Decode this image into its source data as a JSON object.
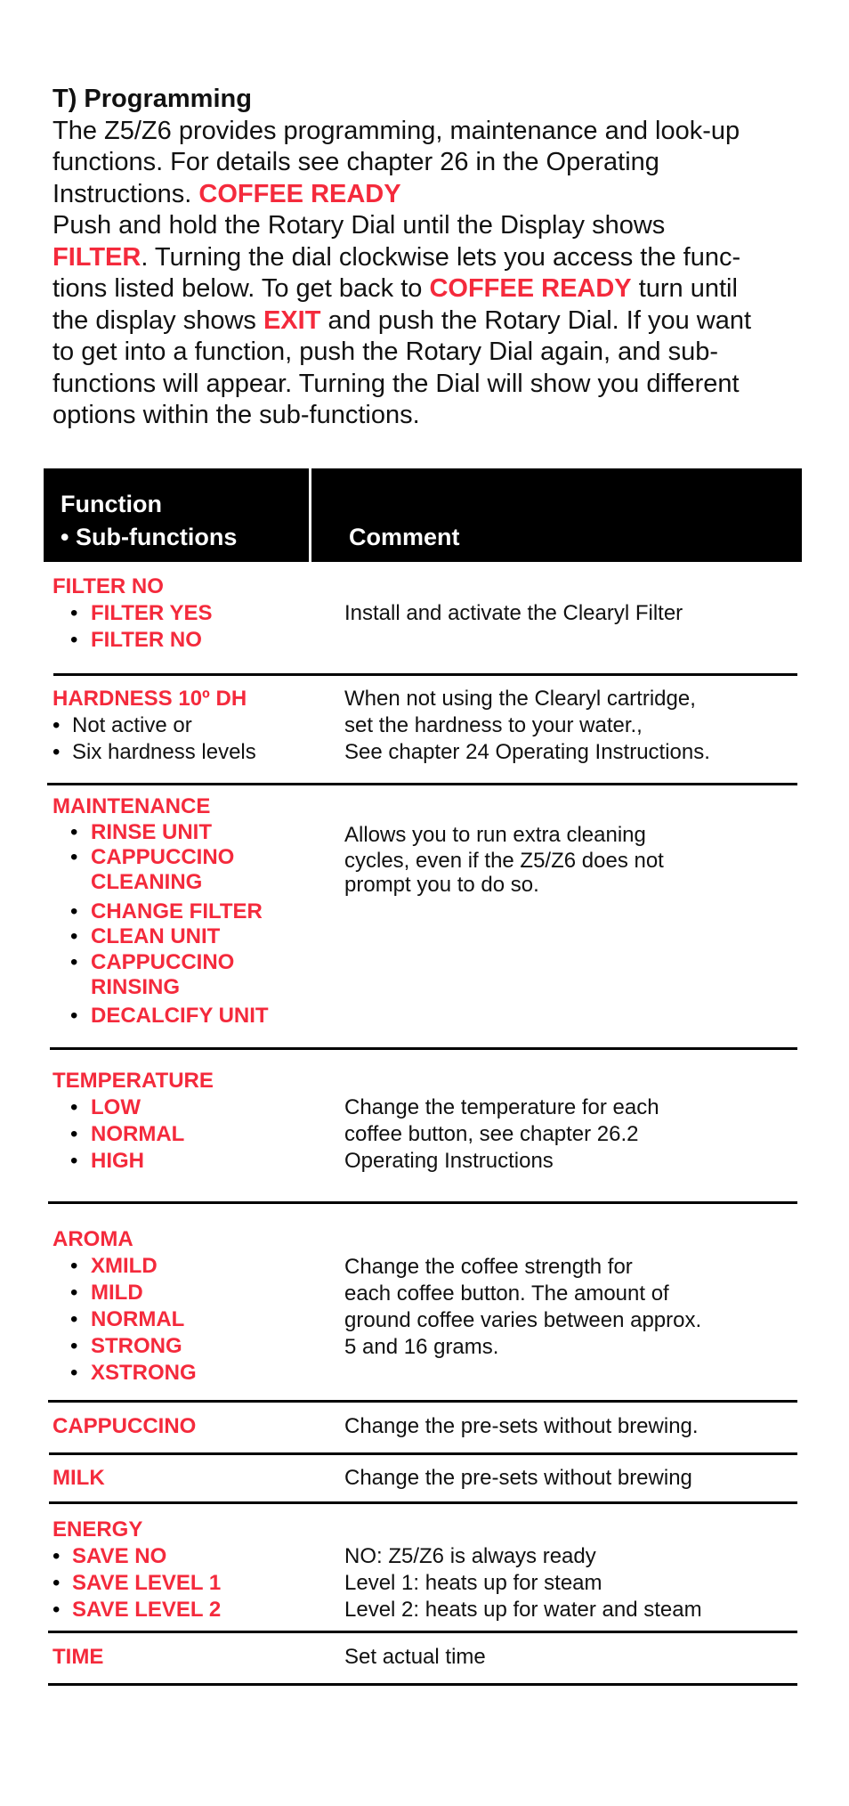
{
  "intro": {
    "heading": "T) Programming",
    "lines": [
      [
        {
          "t": "The Z5/Z6 provides programming, maintenance and look-up"
        }
      ],
      [
        {
          "t": "functions. For details see chapter 26 in the Operating"
        }
      ],
      [
        {
          "t": "Instructions. "
        },
        {
          "t": "COFFEE READY",
          "red": true
        }
      ],
      [
        {
          "t": "Push and hold the Rotary Dial until the Display shows"
        }
      ],
      [
        {
          "t": "FILTER",
          "red": true
        },
        {
          "t": ". Turning the dial clockwise lets you access the func-"
        }
      ],
      [
        {
          "t": "tions listed below. To get back to "
        },
        {
          "t": "COFFEE READY",
          "red": true
        },
        {
          "t": " turn until"
        }
      ],
      [
        {
          "t": "the display shows "
        },
        {
          "t": "EXIT",
          "red": true
        },
        {
          "t": " and push the Rotary Dial. If you want"
        }
      ],
      [
        {
          "t": "to get into a function, push the Rotary Dial again, and sub-"
        }
      ],
      [
        {
          "t": "functions will appear. Turning the Dial will show you different"
        }
      ],
      [
        {
          "t": "options within the sub-functions."
        }
      ]
    ]
  },
  "table": {
    "header": {
      "function": "Function",
      "subfunctions": "• Sub-functions",
      "comment": "Comment"
    },
    "rows": {
      "filter": {
        "title": "FILTER NO",
        "subs": [
          "FILTER YES",
          "FILTER NO"
        ],
        "comment": [
          "Install and activate the Clearyl Filter"
        ]
      },
      "hardness": {
        "title": "HARDNESS 10º DH",
        "subs": [
          "Not active or",
          "Six hardness levels"
        ],
        "comment": [
          "When not using the Clearyl cartridge,",
          "set the hardness to your water.,",
          "See chapter 24 Operating Instructions."
        ]
      },
      "maintenance": {
        "title": "MAINTENANCE",
        "subs": [
          "RINSE UNIT",
          "CAPPUCCINO",
          "CLEANING",
          "CHANGE FILTER",
          "CLEAN UNIT",
          "CAPPUCCINO",
          "RINSING",
          "DECALCIFY UNIT"
        ],
        "comment": [
          "Allows you to run extra cleaning",
          "cycles, even if the Z5/Z6 does not",
          "prompt you to do so."
        ]
      },
      "temperature": {
        "title": "TEMPERATURE",
        "subs": [
          "LOW",
          "NORMAL",
          "HIGH"
        ],
        "comment": [
          "Change the temperature for each",
          "coffee button, see chapter 26.2",
          "Operating Instructions"
        ]
      },
      "aroma": {
        "title": "AROMA",
        "subs": [
          "XMILD",
          "MILD",
          "NORMAL",
          "STRONG",
          "XSTRONG"
        ],
        "comment": [
          "Change the coffee strength for",
          "each coffee button. The amount of",
          "ground coffee varies between approx.",
          "5 and 16 grams."
        ]
      },
      "cappuccino": {
        "title": "CAPPUCCINO",
        "comment": [
          "Change the pre-sets without brewing."
        ]
      },
      "milk": {
        "title": "MILK",
        "comment": [
          "Change the pre-sets without brewing"
        ]
      },
      "energy": {
        "title": "ENERGY",
        "subs": [
          "SAVE NO",
          "SAVE LEVEL 1",
          "SAVE LEVEL 2"
        ],
        "comment": [
          "NO: Z5/Z6 is always ready",
          "Level 1: heats up for steam",
          "Level 2: heats up for water and steam"
        ]
      },
      "time": {
        "title": "TIME",
        "comment": [
          "Set actual time"
        ]
      }
    },
    "bullet": "•"
  },
  "colors": {
    "accent_red": "#f42a3c",
    "header_bg": "#000000",
    "text": "#111111"
  }
}
